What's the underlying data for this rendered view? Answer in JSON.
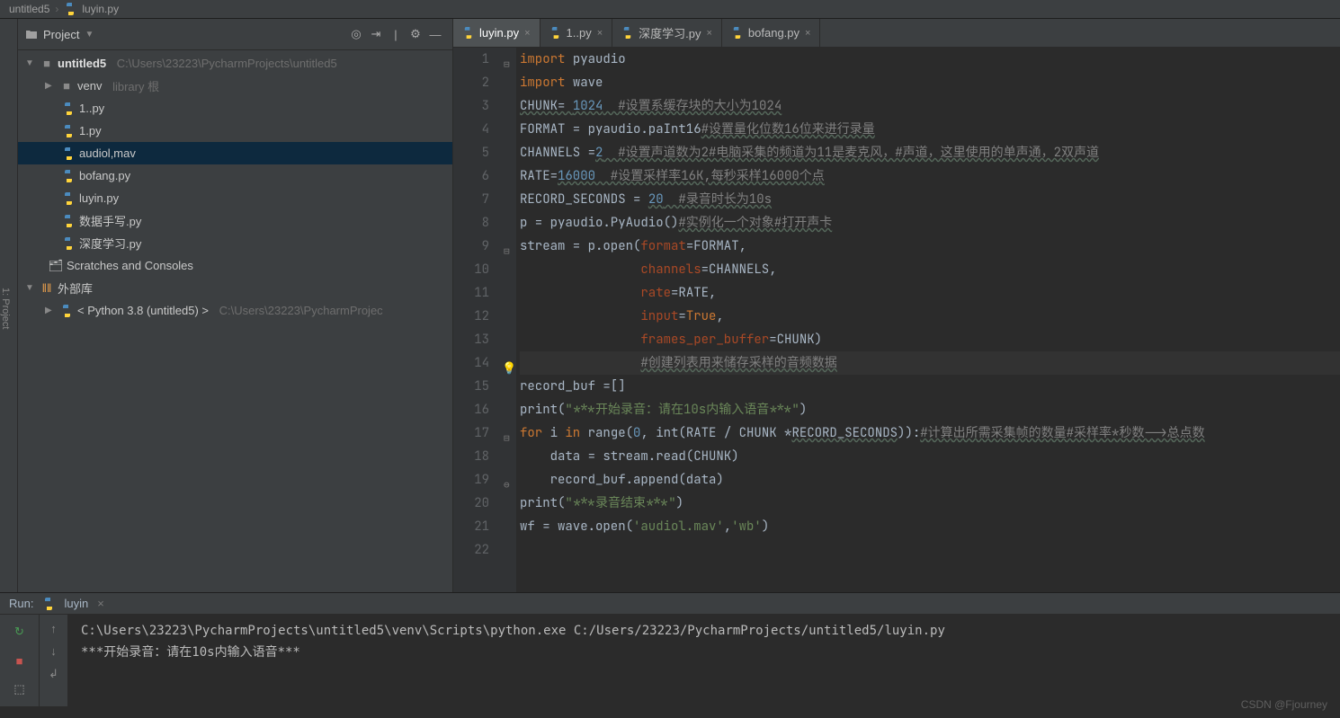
{
  "breadcrumb": {
    "root": "untitled5",
    "file": "luyin.py"
  },
  "sidebar": {
    "title": "Project",
    "root": {
      "name": "untitled5",
      "path": "C:\\Users\\23223\\PycharmProjects\\untitled5"
    },
    "venv": {
      "name": "venv",
      "note": "library 根"
    },
    "files": [
      "1..py",
      "1.py",
      "audiol,mav",
      "bofang.py",
      "luyin.py",
      "数据手写.py",
      "深度学习.py"
    ],
    "selectedFile": "audiol,mav",
    "scratches": "Scratches and Consoles",
    "extLib": "外部库",
    "python": {
      "name": "< Python 3.8 (untitled5) >",
      "path": "C:\\Users\\23223\\PycharmProjec"
    }
  },
  "tabs": [
    {
      "label": "luyin.py",
      "active": true
    },
    {
      "label": "1..py",
      "active": false
    },
    {
      "label": "深度学习.py",
      "active": false
    },
    {
      "label": "bofang.py",
      "active": false
    }
  ],
  "code": {
    "lines": [
      "1",
      "2",
      "3",
      "4",
      "5",
      "6",
      "7",
      "8",
      "9",
      "10",
      "11",
      "12",
      "13",
      "14",
      "15",
      "16",
      "17",
      "18",
      "19",
      "20",
      "21",
      "22"
    ],
    "l1_kw": "import",
    "l1_id": "pyaudio",
    "l2_kw": "import",
    "l2_id": "wave",
    "l3_a": "CHUNK= ",
    "l3_n": "1024",
    "l3_c": "  #设置系缓存块的大小为1024",
    "l4_a": "FORMAT = pyaudio.paInt16",
    "l4_c": "#设置量化位数16位来进行录量",
    "l5_a": "CHANNELS =",
    "l5_n": "2",
    "l5_c": "  #设置声道数为2#电脑采集的频道为11是麦克风，#声道，这里使用的单声通，2双声道",
    "l6_a": "RATE=",
    "l6_n": "16000",
    "l6_c": "  #设置采样率16K,每秒采样16000个点",
    "l7_a": "RECORD_SECONDS = ",
    "l7_n": "20",
    "l7_c": "  #录音时长为10s",
    "l8_a": "p = pyaudio.PyAudio()",
    "l8_c": "#实例化一个对象#打开声卡",
    "l9_a": "stream = p.open(",
    "l9_p": "format",
    "l9_b": "=FORMAT,",
    "l10_p": "channels",
    "l10_b": "=CHANNELS,",
    "l11_p": "rate",
    "l11_b": "=RATE,",
    "l12_p": "input",
    "l12_b": "=",
    "l12_v": "True",
    "l12_e": ",",
    "l13_p": "frames_per_buffer",
    "l13_b": "=CHUNK)",
    "l14_c": "#创建列表用来储存采样的音频数据",
    "l15": "record_buf =[]",
    "l16_a": "print(",
    "l16_s": "\"***开始录音：请在10s内输入语音***\"",
    "l16_b": ")",
    "l17_kw1": "for",
    "l17_a": " i ",
    "l17_kw2": "in",
    "l17_b": " range(",
    "l17_n": "0",
    "l17_c": ", int(RATE / CHUNK *",
    "l17_u": "RECORD_SECONDS",
    "l17_d": ")):",
    "l17_cmt": "#计算出所需采集帧的数量#采样率*秒数-->总点数",
    "l18": "    data = stream.read(CHUNK)",
    "l19": "    record_buf.append(data)",
    "l20_a": "print(",
    "l20_s": "\"***录音结束***\"",
    "l20_b": ")",
    "l21": "",
    "l22_a": "wf = wave.open(",
    "l22_s1": "'audiol.mav'",
    "l22_m": ",",
    "l22_s2": "'wb'",
    "l22_e": ")"
  },
  "run": {
    "label": "Run:",
    "name": "luyin",
    "cmd": "C:\\Users\\23223\\PycharmProjects\\untitled5\\venv\\Scripts\\python.exe C:/Users/23223/PycharmProjects/untitled5/luyin.py",
    "out": "***开始录音：请在10s内输入语音***"
  },
  "watermark": "CSDN @Fjourney"
}
